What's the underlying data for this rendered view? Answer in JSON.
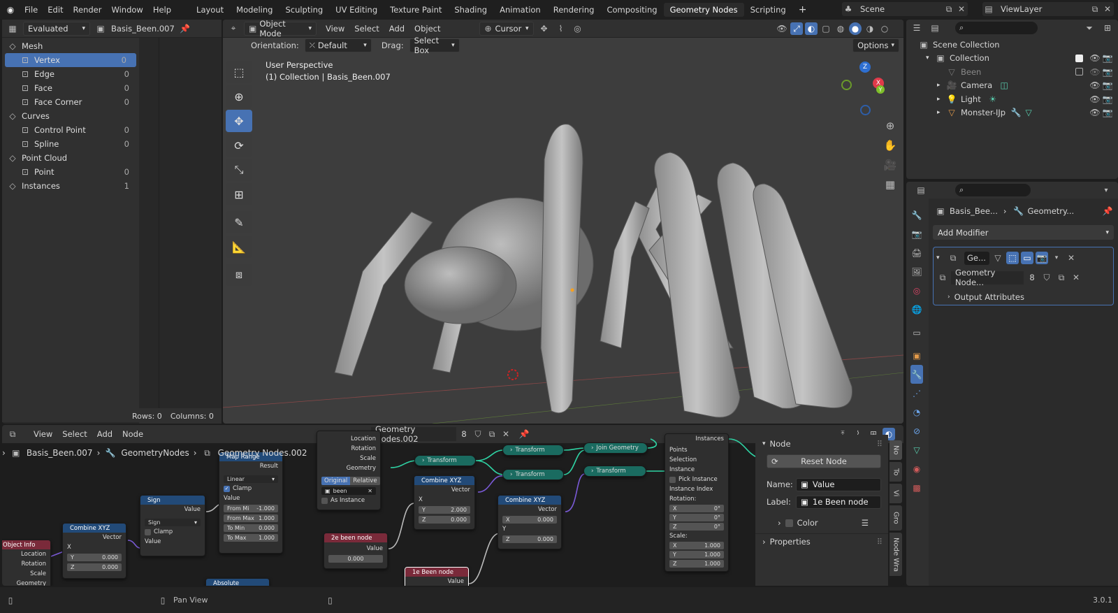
{
  "topbar": {
    "menus": [
      "File",
      "Edit",
      "Render",
      "Window",
      "Help"
    ],
    "workspaces": [
      "Layout",
      "Modeling",
      "Sculpting",
      "UV Editing",
      "Texture Paint",
      "Shading",
      "Animation",
      "Rendering",
      "Compositing",
      "Geometry Nodes",
      "Scripting"
    ],
    "active_workspace": "Geometry Nodes",
    "scene": "Scene",
    "view_layer": "ViewLayer"
  },
  "spreadsheet": {
    "mode": "Evaluated",
    "object": "Basis_Been.007",
    "domains": [
      {
        "label": "Mesh",
        "group": true
      },
      {
        "label": "Vertex",
        "count": "0",
        "active": true
      },
      {
        "label": "Edge",
        "count": "0"
      },
      {
        "label": "Face",
        "count": "0"
      },
      {
        "label": "Face Corner",
        "count": "0"
      },
      {
        "label": "Curves",
        "group": true
      },
      {
        "label": "Control Point",
        "count": "0"
      },
      {
        "label": "Spline",
        "count": "0"
      },
      {
        "label": "Point Cloud",
        "group": true
      },
      {
        "label": "Point",
        "count": "0"
      },
      {
        "label": "Instances",
        "count": "1",
        "group": true
      }
    ],
    "rows": "Rows: 0",
    "columns": "Columns: 0"
  },
  "viewport": {
    "mode": "Object Mode",
    "menus": [
      "View",
      "Select",
      "Add",
      "Object"
    ],
    "pivot": "Cursor",
    "orientation_label": "Orientation:",
    "orientation": "Default",
    "drag_label": "Drag:",
    "drag": "Select Box",
    "options": "Options",
    "perspective": "User Perspective",
    "collection_info": "(1) Collection | Basis_Been.007",
    "gizmo": {
      "x": "X",
      "y": "Y",
      "z": "Z"
    }
  },
  "outliner": {
    "root": "Scene Collection",
    "items": [
      {
        "label": "Collection",
        "level": 1
      },
      {
        "label": "Been",
        "level": 2,
        "dim": true
      },
      {
        "label": "Camera",
        "level": 2
      },
      {
        "label": "Light",
        "level": 2
      },
      {
        "label": "Monster-IJp",
        "level": 2
      }
    ]
  },
  "properties": {
    "breadcrumb_obj": "Basis_Bee...",
    "breadcrumb_mod": "Geometry...",
    "add_modifier": "Add Modifier",
    "modifier_name": "Ge...",
    "node_group": "Geometry Node...",
    "users": "8",
    "output_attrs": "Output Attributes"
  },
  "node_editor": {
    "menus": [
      "View",
      "Select",
      "Add",
      "Node"
    ],
    "tree_name": "Geometry Nodes.002",
    "users": "8",
    "breadcrumb": [
      "Basis_Been.007",
      "GeometryNodes",
      "Geometry Nodes.002"
    ],
    "side_panel": {
      "section": "Node",
      "reset": "Reset Node",
      "name_label": "Name:",
      "name": "Value",
      "label_label": "Label:",
      "label": "1e Been node",
      "color": "Color",
      "properties": "Properties"
    },
    "side_tabs": [
      "No",
      "To",
      "Vi",
      "Gro",
      "Node Wra"
    ]
  },
  "nodes": {
    "object_info": {
      "title": "Object Info",
      "rows": [
        "Location",
        "Rotation",
        "Scale",
        "Geometry"
      ]
    },
    "combine1": {
      "title": "Combine XYZ",
      "out": "Vector",
      "x": "X",
      "y_label": "Y",
      "y": "0.000",
      "z_label": "Z",
      "z": "0.000"
    },
    "sign": {
      "title": "Sign",
      "out": "Value",
      "op": "Sign",
      "clamp": "Clamp",
      "in": "Value"
    },
    "map_range": {
      "title": "Map Range",
      "out": "Result",
      "interp": "Linear",
      "clamp": "Clamp",
      "in": "Value",
      "from_min_l": "From Mi",
      "from_min": "-1.000",
      "from_max_l": "From Max",
      "from_max": "1.000",
      "to_min_l": "To Min",
      "to_min": "0.000",
      "to_max_l": "To Max",
      "to_max": "1.000"
    },
    "absolute": {
      "title": "Absolute"
    },
    "obj_info2": {
      "rows": [
        "Location",
        "Rotation",
        "Scale",
        "Geometry"
      ],
      "orig": "Original",
      "rel": "Relative",
      "obj": "been",
      "as_instance": "As Instance"
    },
    "been2e": {
      "title": "2e been node",
      "out": "Value",
      "val": "0.000"
    },
    "been1e": {
      "title": "1e Been node",
      "out": "Value"
    },
    "combine2": {
      "title": "Combine XYZ",
      "out": "Vector",
      "x": "X",
      "y_label": "Y",
      "y": "2.000",
      "z_label": "Z",
      "z": "0.000"
    },
    "combine3": {
      "title": "Combine XYZ",
      "out": "Vector",
      "x_label": "X",
      "x": "0.000",
      "y": "Y",
      "z_label": "Z",
      "z": "0.000"
    },
    "transform1": "Transform",
    "transform2": "Transform",
    "transform3": "Transform",
    "transform4": "Transform",
    "join": "Join Geometry",
    "instance_on_points": {
      "out": "Instances",
      "rows": [
        "Points",
        "Selection",
        "Instance",
        "Pick Instance",
        "Instance Index"
      ],
      "rot": "Rotation:",
      "rx": "0°",
      "ry": "0°",
      "rz": "0°",
      "scale": "Scale:",
      "sx": "1.000",
      "sy": "1.000",
      "sz": "1.000"
    }
  },
  "statusbar": {
    "action": "Pan View",
    "version": "3.0.1"
  }
}
